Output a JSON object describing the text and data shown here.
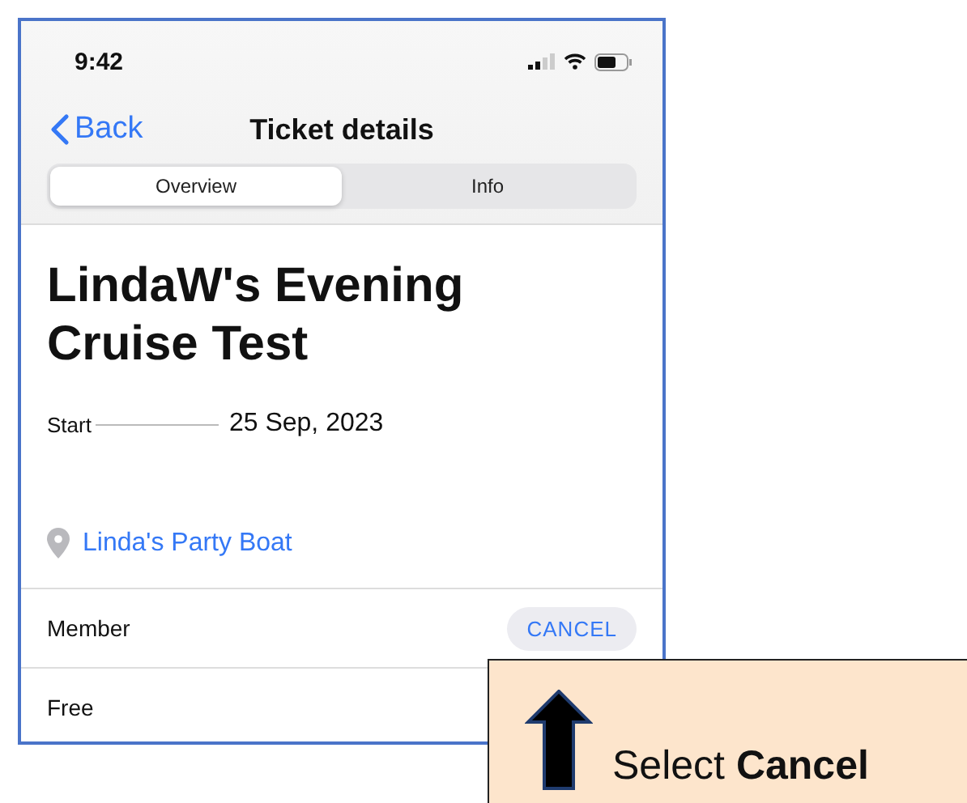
{
  "status_bar": {
    "time": "9:42"
  },
  "nav": {
    "back": "Back",
    "title": "Ticket details"
  },
  "tabs": [
    {
      "label": "Overview",
      "selected": true
    },
    {
      "label": "Info",
      "selected": false
    }
  ],
  "event": {
    "title": "LindaW's Evening Cruise Test",
    "start_label": "Start",
    "start_value": "25 Sep, 2023",
    "location": "Linda's Party Boat"
  },
  "tickets": [
    {
      "name": "Member",
      "action": "CANCEL"
    },
    {
      "name": "Free"
    }
  ],
  "callout": {
    "text": "Select **Cancel**"
  }
}
